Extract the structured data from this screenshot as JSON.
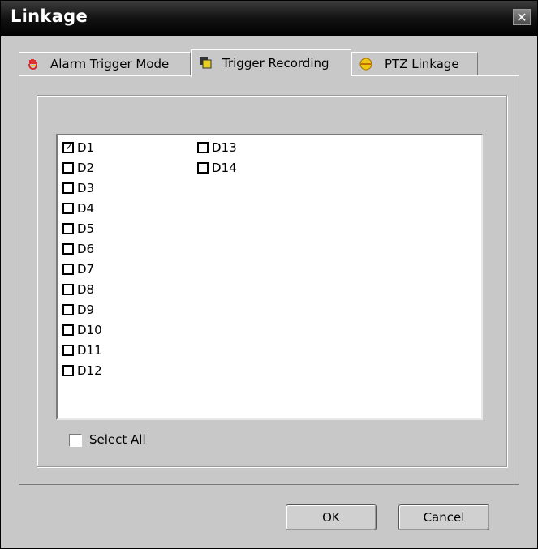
{
  "window": {
    "title": "Linkage",
    "close_label": "✕"
  },
  "tabs": [
    {
      "label": "Alarm Trigger Mode",
      "icon": "hand-icon",
      "active": false
    },
    {
      "label": "Trigger Recording",
      "icon": "recording-icon",
      "active": true
    },
    {
      "label": "PTZ Linkage",
      "icon": "ptz-icon",
      "active": false
    }
  ],
  "channels": [
    {
      "label": "D1",
      "checked": true
    },
    {
      "label": "D2",
      "checked": false
    },
    {
      "label": "D3",
      "checked": false
    },
    {
      "label": "D4",
      "checked": false
    },
    {
      "label": "D5",
      "checked": false
    },
    {
      "label": "D6",
      "checked": false
    },
    {
      "label": "D7",
      "checked": false
    },
    {
      "label": "D8",
      "checked": false
    },
    {
      "label": "D9",
      "checked": false
    },
    {
      "label": "D10",
      "checked": false
    },
    {
      "label": "D11",
      "checked": false
    },
    {
      "label": "D12",
      "checked": false
    },
    {
      "label": "D13",
      "checked": false
    },
    {
      "label": "D14",
      "checked": false
    }
  ],
  "select_all": {
    "label": "Select All",
    "checked": false
  },
  "buttons": {
    "ok": "OK",
    "cancel": "Cancel"
  },
  "colors": {
    "titlebar": "#000000",
    "dialog_bg": "#c8c8c8",
    "list_bg": "#ffffff"
  }
}
